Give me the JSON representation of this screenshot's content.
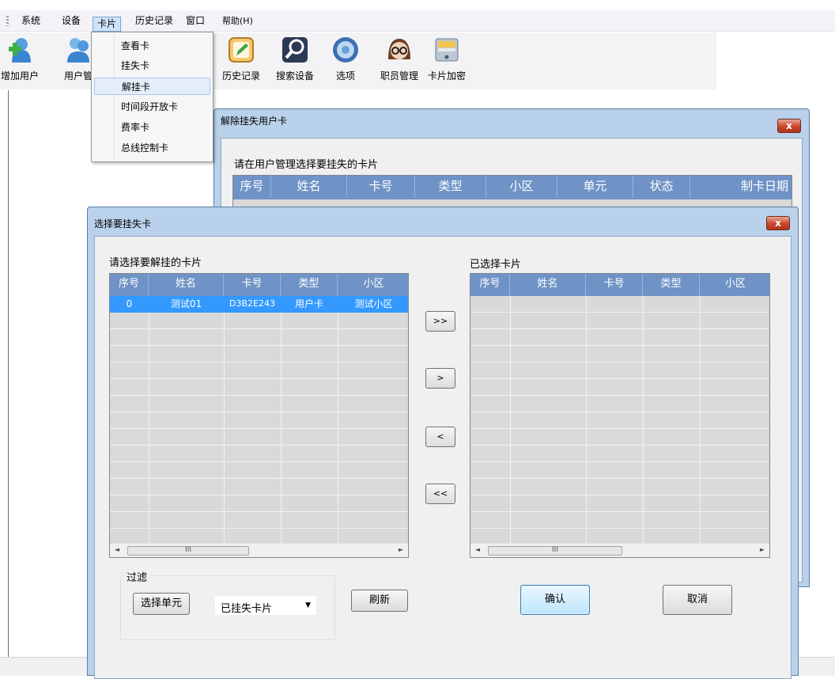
{
  "menubar": {
    "items": [
      "系统",
      "设备",
      "卡片",
      "历史记录",
      "窗口",
      "帮助(H)"
    ],
    "active": "卡片"
  },
  "toolbar": {
    "items": [
      "增加用户",
      "用户管",
      "历史记录",
      "搜索设备",
      "选项",
      "职员管理",
      "卡片加密"
    ]
  },
  "dropdown": {
    "items": [
      "查看卡",
      "挂失卡",
      "解挂卡",
      "时间段开放卡",
      "费率卡",
      "总线控制卡"
    ],
    "selected": "解挂卡"
  },
  "back_dialog": {
    "title": "解除挂失用户卡",
    "close": "x",
    "prompt": "请在用户管理选择要挂失的卡片",
    "columns": [
      "序号",
      "姓名",
      "卡号",
      "类型",
      "小区",
      "单元",
      "状态",
      "制卡日期"
    ]
  },
  "front_dialog": {
    "title": "选择要挂失卡",
    "close": "x",
    "left_label": "请选择要解挂的卡片",
    "right_label": "已选择卡片",
    "left_columns": [
      "序号",
      "姓名",
      "卡号",
      "类型",
      "小区"
    ],
    "right_columns": [
      "序号",
      "姓名",
      "卡号",
      "类型",
      "小区"
    ],
    "left_rows": [
      [
        "0",
        "测试01",
        "D3B2E243",
        "用户卡",
        "测试小区"
      ]
    ],
    "scroll_left": "◄",
    "scroll_right": "►",
    "scroll_thumb": "III",
    "move_buttons": [
      ">>",
      ">",
      "<",
      "<<"
    ],
    "filter": {
      "legend": "过滤",
      "select_unit": "选择单元",
      "combo_value": "已挂失卡片",
      "combo_arrow": "▼",
      "refresh": "刷新"
    },
    "confirm": "确认",
    "cancel": "取消"
  },
  "colors": {
    "grid_header": "#6f93c6",
    "selected_row": "#3399ff",
    "window_frame": "#b9d1ea",
    "close_button": "#c9462c"
  }
}
